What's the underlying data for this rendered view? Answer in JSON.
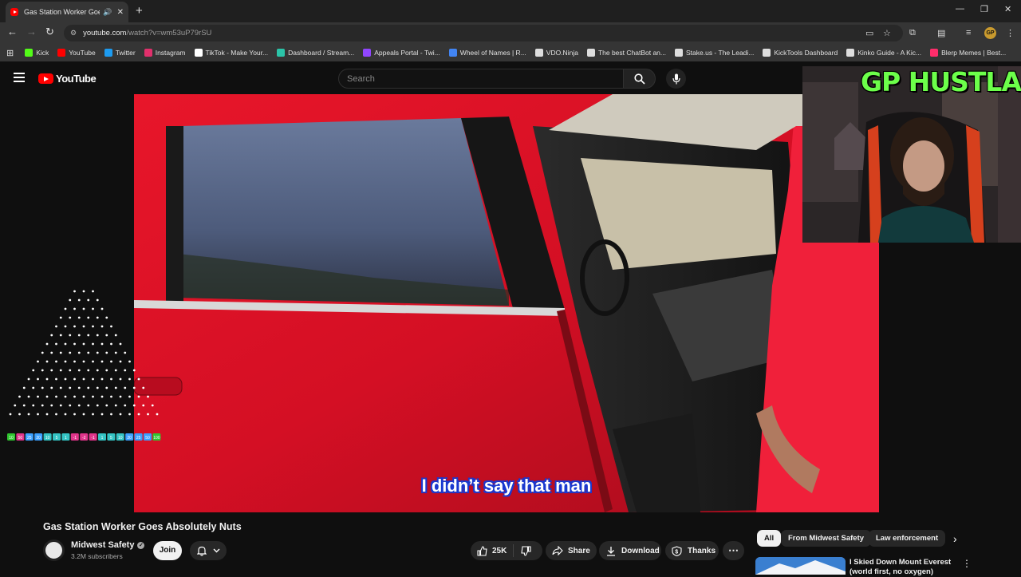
{
  "browser": {
    "tab_title": "Gas Station Worker Goes A",
    "url_host": "youtube.com",
    "url_path": "/watch?v=wm53uP79rSU",
    "profile_initials": "GP",
    "bookmarks": [
      {
        "label": "Kick",
        "color": "#53fc18"
      },
      {
        "label": "YouTube",
        "color": "#ff0000"
      },
      {
        "label": "Twitter",
        "color": "#1d9bf0"
      },
      {
        "label": "Instagram",
        "color": "#e1306c"
      },
      {
        "label": "TikTok - Make Your...",
        "color": "#ffffff"
      },
      {
        "label": "Dashboard / Stream...",
        "color": "#2bc4a8"
      },
      {
        "label": "Appeals Portal - Twi...",
        "color": "#9146ff"
      },
      {
        "label": "Wheel of Names | R...",
        "color": "#4285f4"
      },
      {
        "label": "VDO.Ninja",
        "color": "#dddddd"
      },
      {
        "label": "The best ChatBot an...",
        "color": "#dddddd"
      },
      {
        "label": "Stake.us - The Leadi...",
        "color": "#dddddd"
      },
      {
        "label": "KickTools Dashboard",
        "color": "#dddddd"
      },
      {
        "label": "Kinko Guide - A Kic...",
        "color": "#dddddd"
      },
      {
        "label": "Blerp Memes | Best...",
        "color": "#ff2d6b"
      }
    ]
  },
  "youtube": {
    "logo_text": "YouTube",
    "search_placeholder": "Search"
  },
  "player": {
    "subtitle": "I didn’t say that man"
  },
  "webcam": {
    "overlay_text": "GP HUSTLA"
  },
  "left_overlay": {
    "numbers": [
      "10",
      "50",
      "25",
      "20",
      "10",
      "5",
      "1",
      "-1",
      "-2",
      "-1",
      "1",
      "5",
      "10",
      "20",
      "25",
      "50",
      "100"
    ]
  },
  "video": {
    "title": "Gas Station Worker Goes Absolutely Nuts",
    "channel": "Midwest Safety",
    "subscribers": "3.2M subscribers",
    "join_label": "Join",
    "likes": "25K",
    "share_label": "Share",
    "download_label": "Download",
    "thanks_label": "Thanks"
  },
  "chips": [
    "All",
    "From Midwest Safety",
    "Law enforcement"
  ],
  "recommendation": {
    "title": "I Skied Down Mount Everest (world first, no oxygen)"
  }
}
